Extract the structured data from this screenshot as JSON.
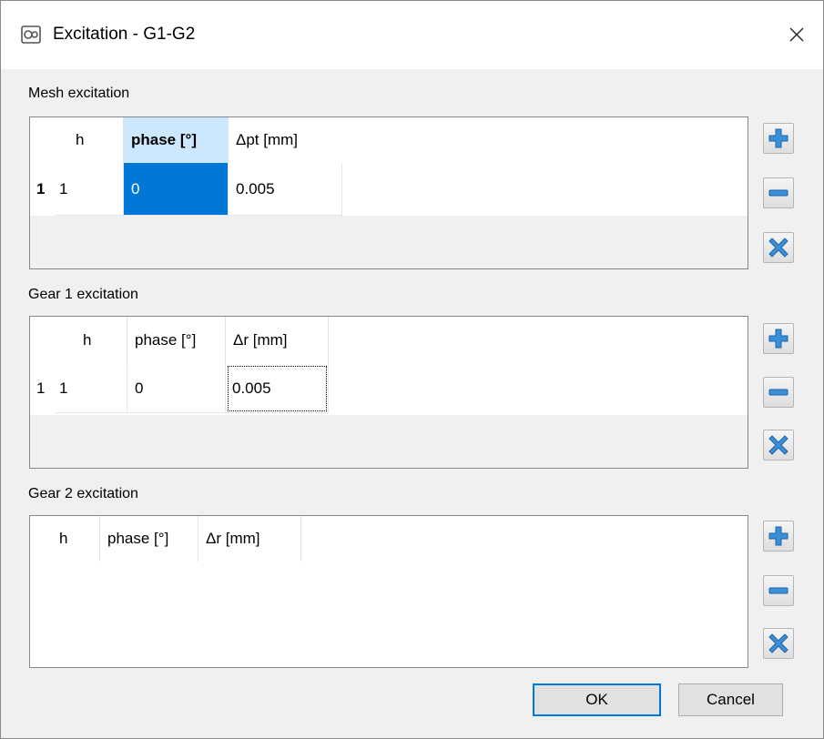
{
  "window": {
    "title": "Excitation - G1-G2",
    "close_glyph": "✕"
  },
  "mesh": {
    "label": "Mesh excitation",
    "columns": [
      "h",
      "phase [°]",
      "Δpt [mm]"
    ],
    "rows": [
      {
        "index": "1",
        "cells": [
          "1",
          "0",
          "0.005"
        ]
      }
    ]
  },
  "gear1": {
    "label": "Gear 1 excitation",
    "columns": [
      "h",
      "phase [°]",
      "Δr [mm]"
    ],
    "rows": [
      {
        "index": "1",
        "cells": [
          "1",
          "0",
          "0.005"
        ]
      }
    ]
  },
  "gear2": {
    "label": "Gear 2 excitation",
    "columns": [
      "h",
      "phase [°]",
      "Δr [mm]"
    ],
    "rows": []
  },
  "side_buttons": {
    "add": "plus-icon",
    "remove": "minus-icon",
    "clear": "x-icon"
  },
  "buttons": {
    "ok": "OK",
    "cancel": "Cancel"
  },
  "colors": {
    "accent": "#0078d7",
    "icon_blue": "#3b8fd9",
    "header_selected": "#cce8ff"
  }
}
